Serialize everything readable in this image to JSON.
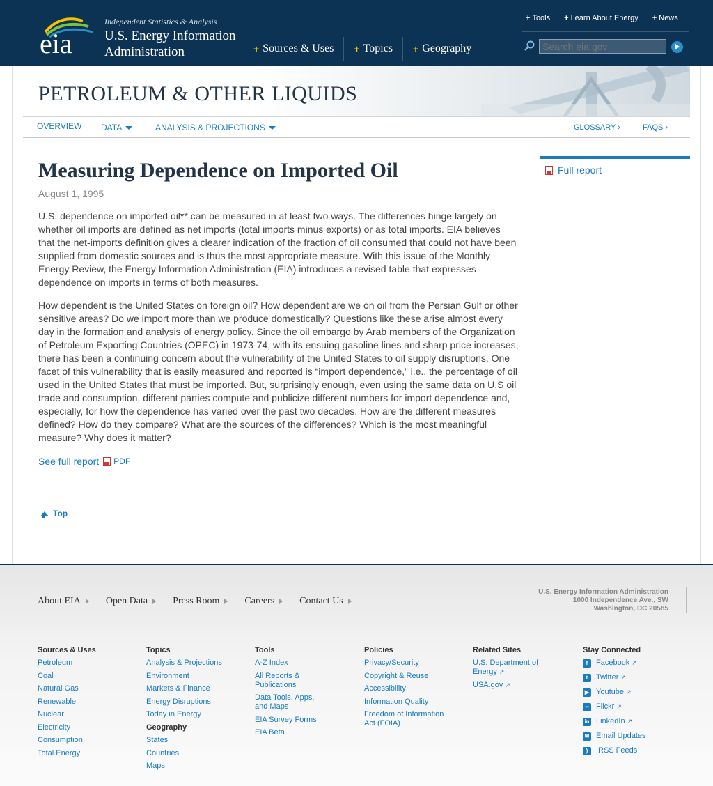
{
  "header": {
    "tagline": "Independent Statistics & Analysis",
    "org_line1": "U.S. Energy Information",
    "org_line2": "Administration",
    "logo_text": "eia",
    "nav": [
      "Sources & Uses",
      "Topics",
      "Geography"
    ],
    "top_links": [
      "Tools",
      "Learn About Energy",
      "News"
    ],
    "search_placeholder": "Search eia.gov"
  },
  "banner": {
    "title": "PETROLEUM & OTHER LIQUIDS"
  },
  "subnav": {
    "overview": "OVERVIEW",
    "data": "DATA",
    "analysis": "ANALYSIS & PROJECTIONS",
    "glossary": "GLOSSARY ›",
    "faqs": "FAQS ›"
  },
  "article": {
    "title": "Measuring Dependence on Imported Oil",
    "date": "August 1, 1995",
    "paragraph1": "U.S. dependence on imported oil** can be measured in at least two ways. The differences hinge largely on whether oil imports are defined as net imports (total imports minus exports) or as total imports. EIA believes that the net-imports definition gives a clearer indication of the fraction of oil consumed that could not have been supplied from domestic sources and is thus the most appropriate measure. With this issue of the Monthly Energy Review, the Energy Information Administration (EIA) introduces a revised table that expresses dependence on imports in terms of both measures.",
    "paragraph2": "How dependent is the United States on foreign oil? How dependent are we on oil from the Persian Gulf or other sensitive areas? Do we import more than we produce domestically? Questions like these arise almost every day in the formation and analysis of energy policy. Since the oil embargo by Arab members of the Organization of Petroleum Exporting Countries (OPEC) in 1973-74, with its ensuing gasoline lines and sharp price increases, there has been a continuing concern about the vulnerability of the United States to oil supply disruptions. One facet of this vulnerability that is easily measured and reported is “import dependence,” i.e., the percentage of oil used in the United States that must be imported. But, surprisingly enough, even using the same data on U.S oil trade and consumption, different parties compute and publicize different numbers for import dependence and, especially, for how the dependence has varied over the past two decades. How are the different measures defined? How do they compare? What are the sources of the differences? Which is the most meaningful measure? Why does it matter?",
    "full_report_link": "See full report",
    "pdf_label": "PDF",
    "top_link": "Top"
  },
  "sidebar": {
    "full_report": "Full report"
  },
  "footer": {
    "nav": [
      "About EIA",
      "Open Data",
      "Press Room",
      "Careers",
      "Contact Us"
    ],
    "address": [
      "U.S. Energy Information Administration",
      "1000 Independence Ave., SW",
      "Washington, DC 20585"
    ],
    "columns": {
      "sources": {
        "heading": "Sources & Uses",
        "links": [
          "Petroleum",
          "Coal",
          "Natural Gas",
          "Renewable",
          "Nuclear",
          "Electricity",
          "Consumption",
          "Total Energy"
        ]
      },
      "topics": {
        "heading": "Topics",
        "links": [
          "Analysis & Projections",
          "Environment",
          "Markets & Finance",
          "Energy Disruptions",
          "Today in Energy"
        ],
        "subheading": "Geography",
        "links2": [
          "States",
          "Countries",
          "Maps"
        ]
      },
      "tools": {
        "heading": "Tools",
        "links": [
          "A-Z Index",
          "All Reports & Publications",
          "Data Tools, Apps, and Maps",
          "EIA Survey Forms",
          "EIA Beta"
        ]
      },
      "policies": {
        "heading": "Policies",
        "links": [
          "Privacy/Security",
          "Copyright & Reuse",
          "Accessibility",
          "Information Quality",
          "Freedom of Information Act (FOIA)"
        ]
      },
      "related": {
        "heading": "Related Sites",
        "links": [
          "U.S. Department of Energy",
          "USA.gov"
        ]
      },
      "social": {
        "heading": "Stay Connected",
        "links": [
          "Facebook",
          "Twitter",
          "Youtube",
          "Flickr",
          "LinkedIn",
          "Email Updates",
          "RSS Feeds"
        ]
      }
    }
  },
  "colors": {
    "header_bg": "#0c3353",
    "link": "#1a7cbf",
    "accent": "#f4c400"
  }
}
